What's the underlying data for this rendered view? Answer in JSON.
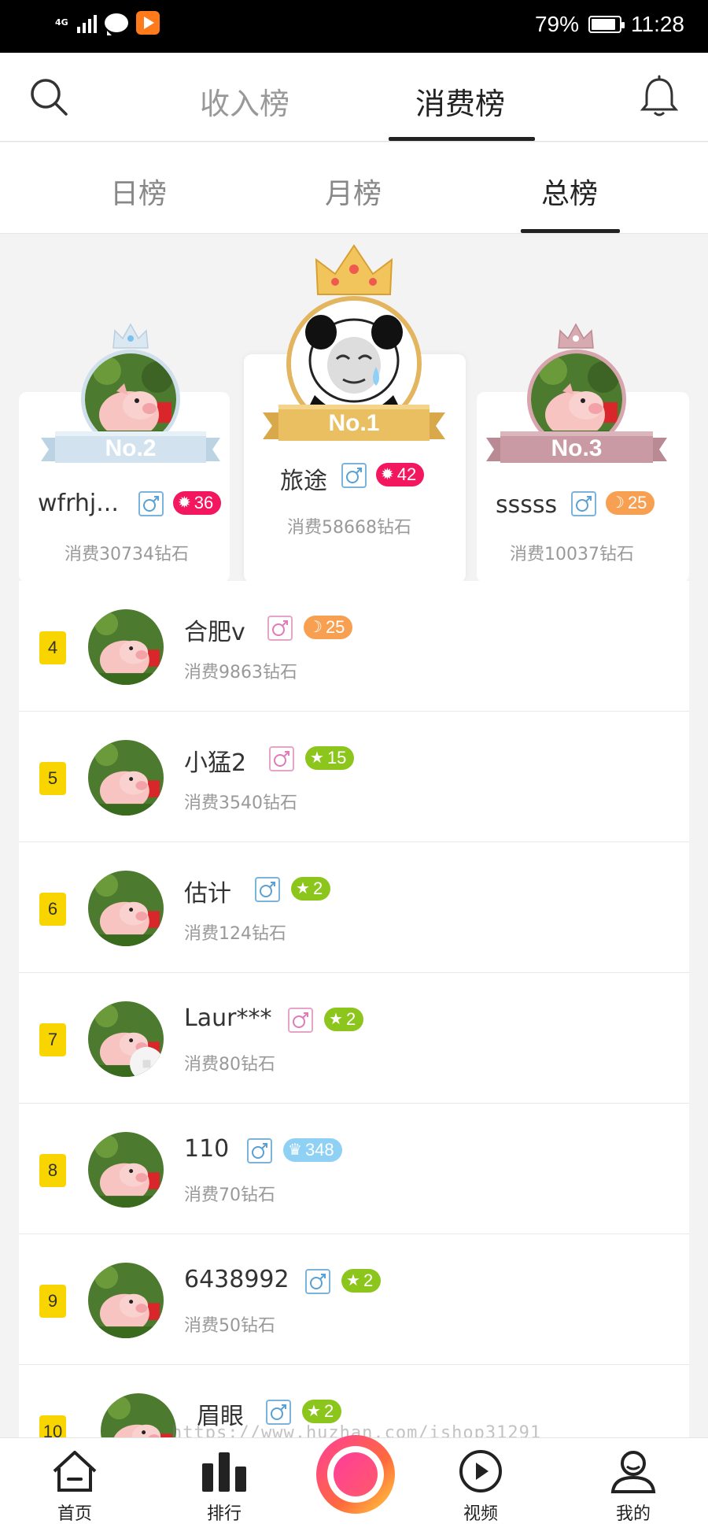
{
  "status_bar": {
    "network": "4G",
    "battery": "79%",
    "time": "11:28"
  },
  "top_tabs": [
    "收入榜",
    "消费榜"
  ],
  "top_tab_active": "消费榜",
  "sub_tabs": [
    "日榜",
    "月榜",
    "总榜"
  ],
  "sub_tab_active": "总榜",
  "podium": {
    "first": {
      "rank_label": "No.1",
      "name": "旅途",
      "gender": "male",
      "level_badge": "42",
      "spend": "消费58668钻石"
    },
    "second": {
      "rank_label": "No.2",
      "name": "wfrhj...",
      "gender": "male",
      "level_badge": "36",
      "spend": "消费30734钻石"
    },
    "third": {
      "rank_label": "No.3",
      "name": "sssss",
      "gender": "male",
      "level_badge": "25",
      "spend": "消费10037钻石"
    }
  },
  "rows": [
    {
      "rank": "4",
      "name": "合肥v",
      "gender": "female",
      "badge": "25",
      "spend": "消费9863钻石"
    },
    {
      "rank": "5",
      "name": "小猛2",
      "gender": "female",
      "badge": "15",
      "spend": "消费3540钻石"
    },
    {
      "rank": "6",
      "name": "估计",
      "gender": "male",
      "badge": "2",
      "spend": "消费124钻石"
    },
    {
      "rank": "7",
      "name": "Laur***",
      "gender": "female",
      "badge": "2",
      "spend": "消费80钻石"
    },
    {
      "rank": "8",
      "name": "110",
      "gender": "male",
      "badge": "348",
      "spend": "消费70钻石"
    },
    {
      "rank": "9",
      "name": "6438992",
      "gender": "male",
      "badge": "2",
      "spend": "消费50钻石"
    },
    {
      "rank": "10",
      "name": "眉眼",
      "gender": "male",
      "badge": "2",
      "spend": ""
    }
  ],
  "watermark": "https://www.huzhan.com/ishop31291",
  "bottom_nav": {
    "home": "首页",
    "rank": "排行",
    "video": "视频",
    "mine": "我的"
  },
  "colors": {
    "accent_yellow": "#f9d500",
    "badge_pink": "#f2175f",
    "badge_orange": "#f8a052",
    "badge_green": "#8cc61c",
    "badge_blue": "#8fd0f5",
    "gold": "#e3b55e",
    "silver": "#cfe0ec",
    "bronze": "#d8a4ad"
  }
}
